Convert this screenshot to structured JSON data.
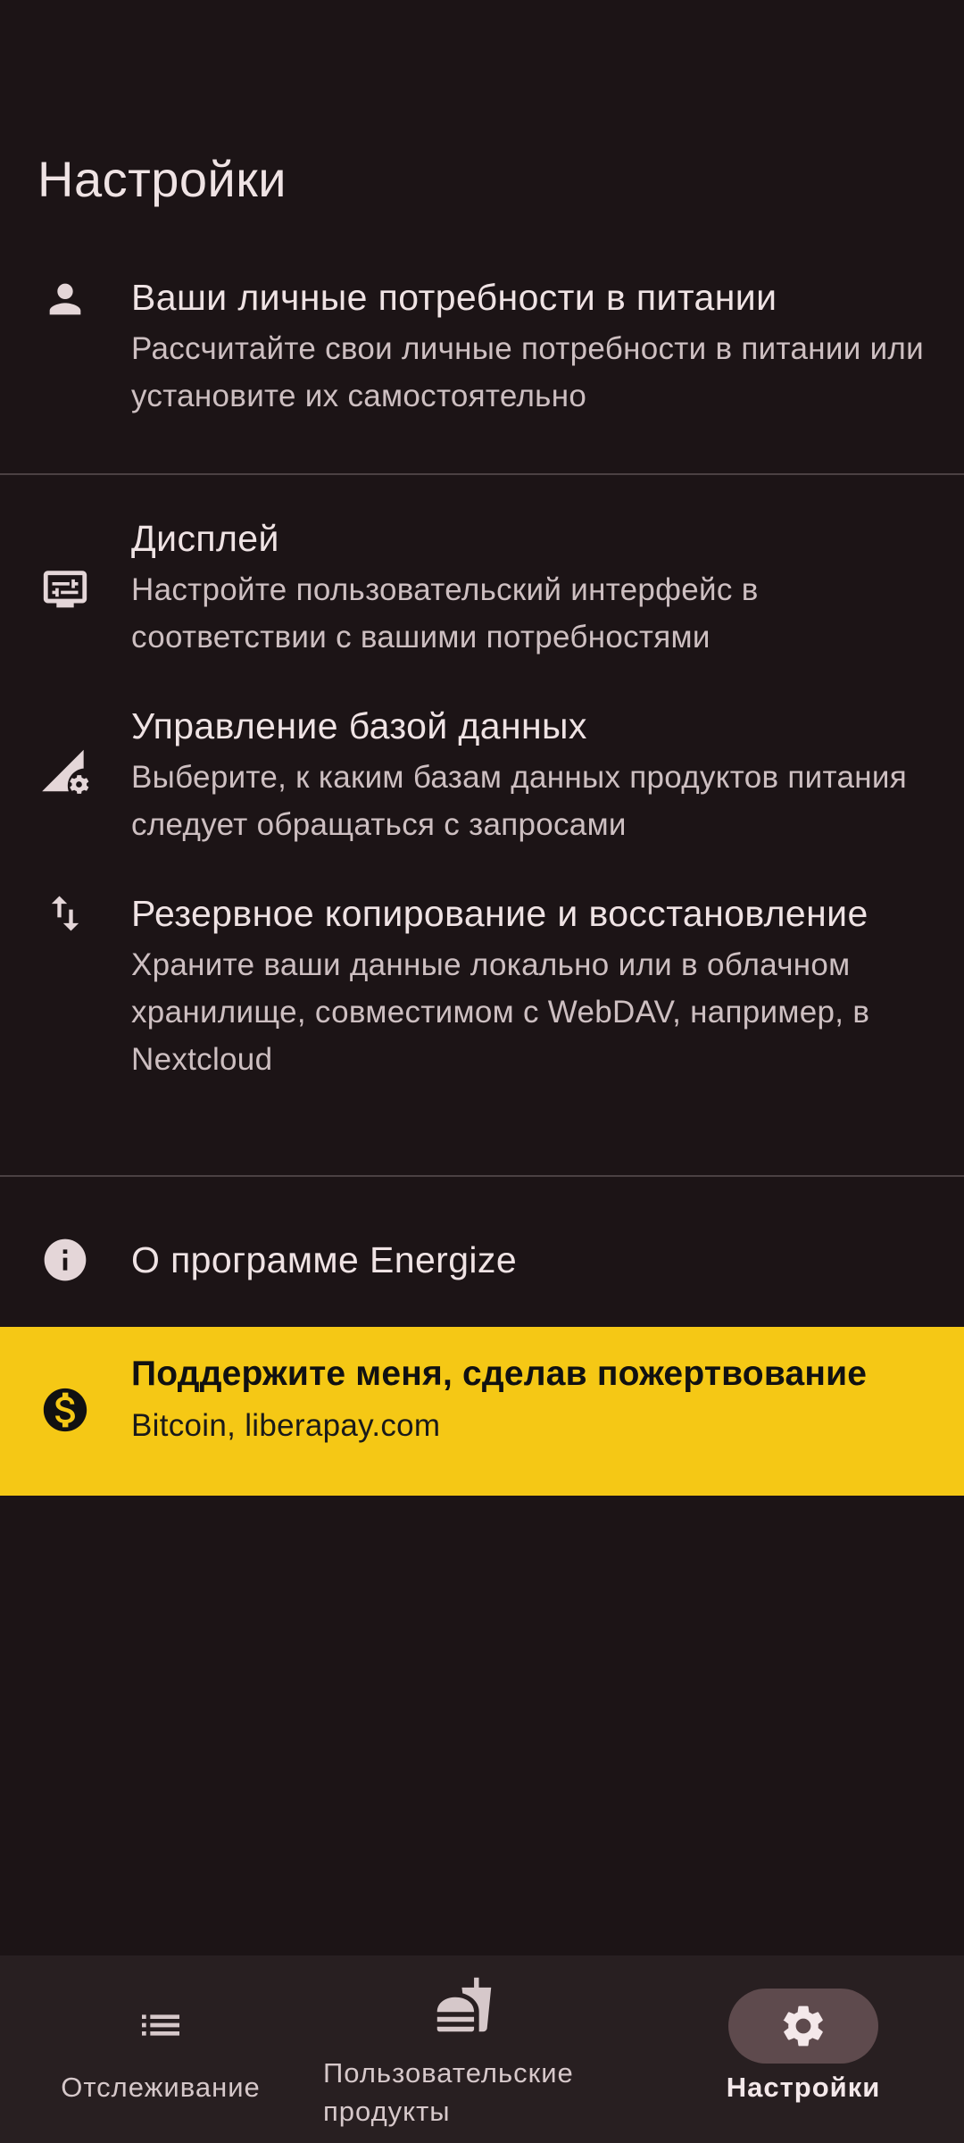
{
  "page": {
    "title": "Настройки"
  },
  "settings": {
    "nutrition": {
      "title": "Ваши личные потребности в питании",
      "sub": "Рассчитайте свои личные потребности в питании или установите их самостоятельно",
      "icon": "person-icon"
    },
    "display": {
      "title": "Дисплей",
      "sub": "Настройте пользовательский интерфейс в соответствии с вашими потребностями",
      "icon": "display-settings-icon"
    },
    "database": {
      "title": "Управление базой данных",
      "sub": "Выберите, к каким базам данных продуктов питания следует обращаться с запросами",
      "icon": "database-settings-icon"
    },
    "backup": {
      "title": "Резервное копирование и восстановление",
      "sub": "Храните ваши данные локально или в облачном хранилище, совместимом с WebDAV, например, в Nextcloud",
      "icon": "swap-vertical-icon"
    },
    "about": {
      "title": "О программе Energize",
      "icon": "info-icon"
    },
    "donate": {
      "title": "Поддержите меня, сделав пожертвование",
      "sub": "Bitcoin, liberapay.com",
      "icon": "dollar-icon",
      "bg_color": "#f5c815"
    }
  },
  "nav": {
    "tracking": {
      "label": "Отслеживание",
      "icon": "list-icon"
    },
    "products": {
      "label": "Пользовательские продукты",
      "icon": "fastfood-icon"
    },
    "settings": {
      "label": "Настройки",
      "icon": "gear-icon",
      "active": true
    }
  },
  "colors": {
    "background": "#1c1416",
    "accent": "#f5c815",
    "nav_background": "#281f21",
    "nav_active_pill": "#5e4a4d"
  }
}
